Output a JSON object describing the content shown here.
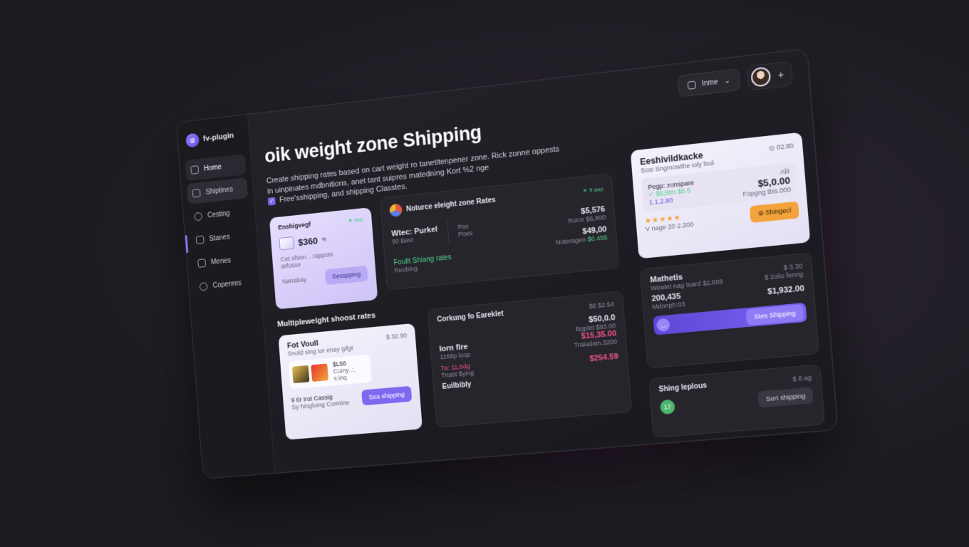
{
  "brand": {
    "name": "fv-plugin"
  },
  "nav": {
    "items": [
      {
        "label": "Home"
      },
      {
        "label": "Shiptines"
      },
      {
        "label": "Cesting"
      },
      {
        "label": "Stanes"
      },
      {
        "label": "Menes"
      },
      {
        "label": "Copenres"
      }
    ]
  },
  "topbar": {
    "select_label": "Inme",
    "plus": "+"
  },
  "header": {
    "title": "oik weight zone Shipping",
    "subtitle": "Create shipping rates based on cart weight ro tanetitenpener zone. Rick zonne oppests in uinpinates mdbnitions, anet tant suipres matedning Kort %2 nge",
    "check_label": "Free'sshipping, and shipping Classtes."
  },
  "card_lav": {
    "title": "Enshigvegf",
    "tag": "★ aop",
    "price": "$360",
    "price_sup": "%",
    "desc": "Cet shinn .. rappots",
    "desc2": "arfusse",
    "foot_label": "Nanabay",
    "button": "Sesspping"
  },
  "card_zone": {
    "title": "Noturce eleight zone Rates",
    "meta": "⚭ 9 aop",
    "left_title": "Wtec: Purkel",
    "left_sub": "90 Bast",
    "mid_title": "Pas",
    "mid_sub": "Poes",
    "price1": "$5,576",
    "price1_sub": "Roror $6,800",
    "price2": "$49,00",
    "price2_sub": "Noteragen",
    "price2_green": "$0.455",
    "green_label": "Foullt Shiang rates",
    "green_sub": "Reobing"
  },
  "card_right_top": {
    "title": "Eeshivildkacke",
    "meta": "◎ 02.80",
    "sub": "Sosi Sngmowthe ioly lnol",
    "inner_title": "Pegp: zonspare",
    "inner_green": "✓ $6,5tm $5 5",
    "inner_purple": "1.1.2.80",
    "inner_right_label": "Alit",
    "inner_right_price": "$5,0.00",
    "inner_right_sub": "Fopgng tbis.000",
    "stars": "★★★★★",
    "rating_text": "V nage 20 2.200",
    "button": "⊚ Shingecl"
  },
  "section2": {
    "label": "Multiplewelght shoost rates"
  },
  "card_fot": {
    "title": "Fot Voull",
    "meta": "$ 32.90",
    "sub": "Snold sing tor enay gifgt",
    "mini_title": "$L56",
    "mini_sub": "Cuiny .:. s:inq",
    "foot_title": "9 6r Irot Cassig",
    "foot_sub": "Sy hingloing Comtine",
    "button": "Sea shipping"
  },
  "card_center": {
    "title": "Corkung fo Eareklet",
    "meta": "$8 $2.54",
    "price1": "$50,0.0",
    "price1_sub": "Bgplet $93.00",
    "row2_title": "Iorn fire",
    "row2_sub": "1169p loop",
    "price2": "$15,35.00",
    "price2_sub": "Traladain.3200",
    "pink_title": "7a: 11,6dg",
    "pink_sub": "Tnast $ying",
    "price3": "$254.59",
    "foot": "Euilbibly"
  },
  "card_math": {
    "title": "Mathetis",
    "meta": "$ 3.30",
    "sub": "Weatet nag tsard $2.609",
    "right_label": "$ 2olio fenng",
    "right_price": "$1,932.00",
    "qty": "200,435",
    "qty_sub": "Mdonph:03",
    "button": "Stes Shipping"
  },
  "card_bottom_right": {
    "title": "Shing leplous",
    "meta": "$ 8.ag",
    "button": "Sert shipping",
    "chip": "17"
  }
}
